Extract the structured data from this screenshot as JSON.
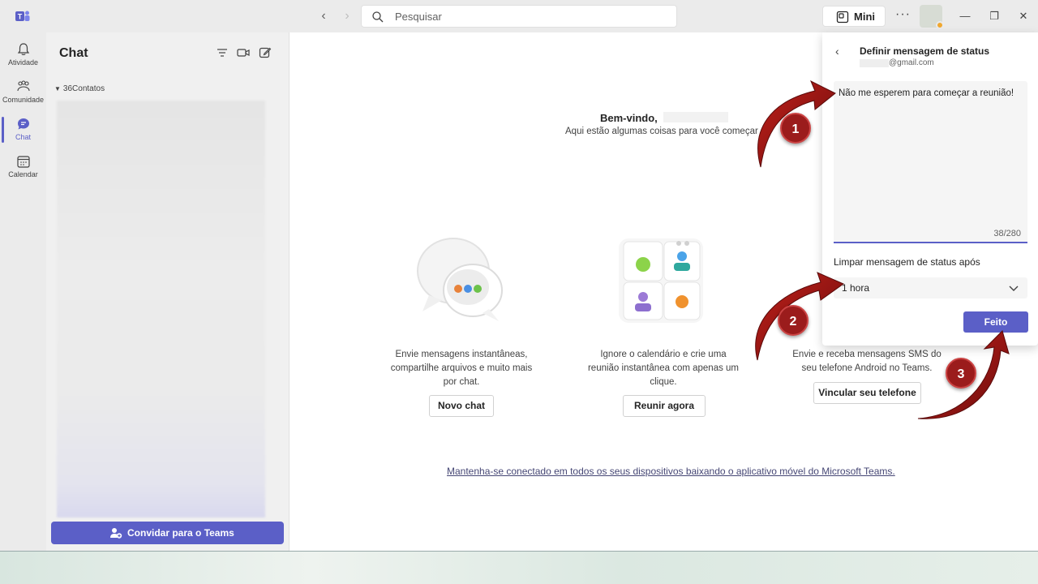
{
  "titlebar": {
    "search_placeholder": "Pesquisar",
    "mini_label": "Mini",
    "more_label": "···"
  },
  "rail": {
    "items": [
      {
        "label": "Atividade",
        "icon": "bell-icon"
      },
      {
        "label": "Comunidade",
        "icon": "community-icon"
      },
      {
        "label": "Chat",
        "icon": "chat-icon"
      },
      {
        "label": "Calendar",
        "icon": "calendar-icon"
      }
    ]
  },
  "chat_pane": {
    "title": "Chat",
    "section": "36Contatos",
    "invite_label": "Convidar para o Teams"
  },
  "main": {
    "welcome": "Bem-vindo,",
    "welcome_sub": "Aqui estão algumas coisas para você começar",
    "cards": [
      {
        "text": "Envie mensagens instantâneas, compartilhe arquivos e muito mais por chat.",
        "button": "Novo chat"
      },
      {
        "text": "Ignore o calendário e crie uma reunião instantânea com apenas um clique.",
        "button": "Reunir agora"
      },
      {
        "text": "Envie e receba mensagens SMS do seu telefone Android no Teams.",
        "button": "Vincular seu telefone"
      }
    ],
    "footer_link": "Mantenha-se conectado em todos os seus dispositivos baixando o aplicativo móvel do Microsoft Teams."
  },
  "status_panel": {
    "title": "Definir mensagem de status",
    "email": "@gmail.com",
    "message": "Não me esperem para começar a reunião!",
    "char_count": "38/280",
    "clear_label": "Limpar mensagem de status após",
    "clear_value": "1 hora",
    "done_label": "Feito"
  },
  "annotations": [
    "1",
    "2",
    "3"
  ],
  "colors": {
    "accent": "#5b5fc7",
    "callout": "#9b1c1c"
  }
}
